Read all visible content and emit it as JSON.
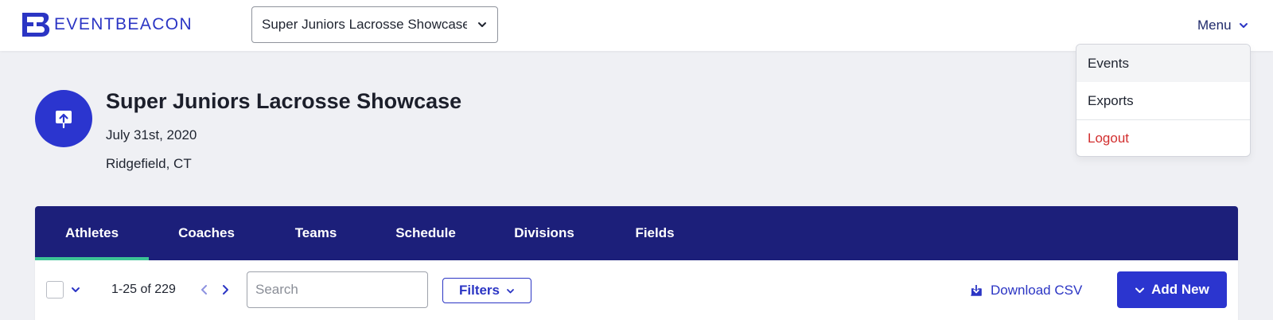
{
  "brand": {
    "name": "EVENTBEACON",
    "accent": "#2b35c4"
  },
  "event_selector": {
    "value": "Super Juniors Lacrosse Showcase",
    "icon": "chevron-down-icon"
  },
  "menu": {
    "label": "Menu",
    "items": [
      {
        "label": "Events",
        "active": true
      },
      {
        "label": "Exports",
        "active": false
      },
      {
        "label": "Logout",
        "active": false,
        "color": "#d22f2f"
      }
    ]
  },
  "event": {
    "title": "Super Juniors Lacrosse Showcase",
    "date": "July 31st, 2020",
    "location": "Ridgefield, CT",
    "icon": "upload-icon"
  },
  "tabs": [
    {
      "label": "Athletes",
      "active": true
    },
    {
      "label": "Coaches",
      "active": false
    },
    {
      "label": "Teams",
      "active": false
    },
    {
      "label": "Schedule",
      "active": false
    },
    {
      "label": "Divisions",
      "active": false
    },
    {
      "label": "Fields",
      "active": false
    }
  ],
  "toolbar": {
    "pagination": "1-25 of 229",
    "search_placeholder": "Search",
    "filters_label": "Filters",
    "download_label": "Download CSV",
    "add_label": "Add New"
  },
  "colors": {
    "tab_bar": "#1c1f7a",
    "active_tab_underline": "#3cc496",
    "primary_button": "#2b35cf",
    "logout": "#d22f2f"
  }
}
